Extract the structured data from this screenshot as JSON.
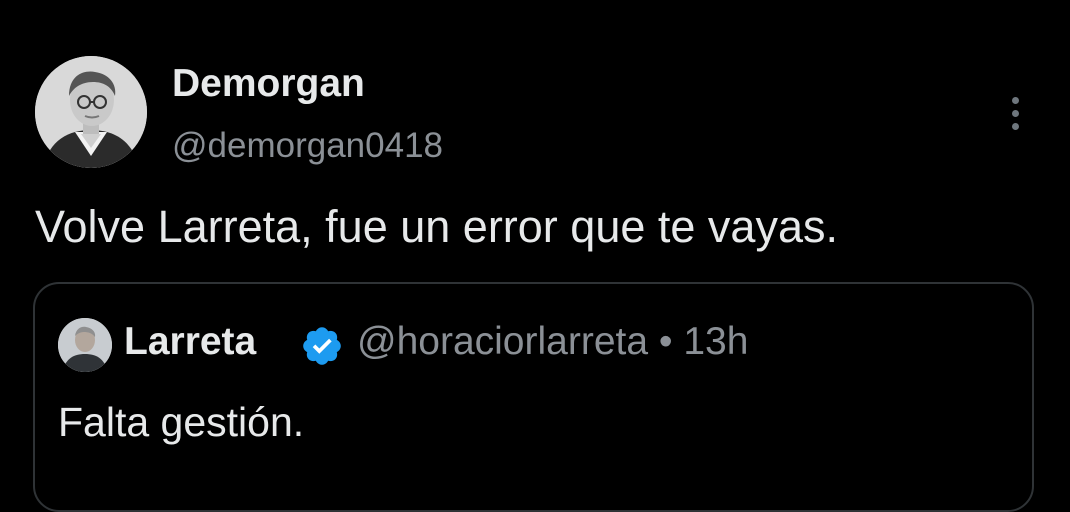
{
  "tweet": {
    "author": {
      "display_name": "Demorgan",
      "handle": "@demorgan0418",
      "avatar": "portrait-avatar"
    },
    "text": "Volve Larreta, fue un error que te vayas.",
    "more_icon": "more-vertical-icon"
  },
  "quoted_tweet": {
    "author": {
      "display_name": "Larreta",
      "handle": "@horaciorlarreta",
      "verified": true,
      "verified_icon": "verified-badge-icon",
      "verified_color": "#1d9bf0"
    },
    "meta": "@horaciorlarreta • 13h",
    "text": "Falta gestión."
  },
  "theme": {
    "background": "#000000",
    "text_primary": "#e7e9ea",
    "text_secondary": "#8b9096",
    "border": "#2f3336"
  }
}
